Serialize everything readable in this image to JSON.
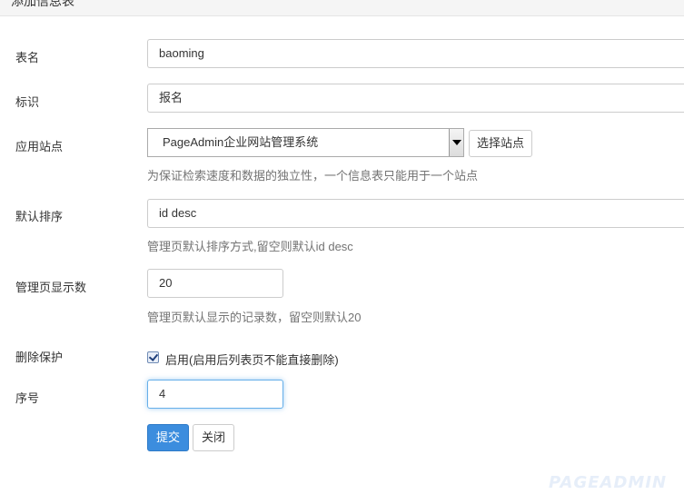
{
  "header": {
    "title": "添加信息表"
  },
  "form": {
    "table_name": {
      "label": "表名",
      "value": "baoming"
    },
    "identifier": {
      "label": "标识",
      "value": "报名"
    },
    "site": {
      "label": "应用站点",
      "selected": "PageAdmin企业网站管理系统",
      "choose_button": "选择站点",
      "hint": "为保证检索速度和数据的独立性，一个信息表只能用于一个站点"
    },
    "default_sort": {
      "label": "默认排序",
      "value": "id desc",
      "hint": "管理页默认排序方式,留空则默认id desc"
    },
    "page_size": {
      "label": "管理页显示数",
      "value": "20",
      "hint": "管理页默认显示的记录数，留空则默认20"
    },
    "delete_protect": {
      "label": "删除保护",
      "checked": true,
      "checkbox_label": "启用(启用后列表页不能直接删除)"
    },
    "order": {
      "label": "序号",
      "value": "4"
    }
  },
  "actions": {
    "submit": "提交",
    "close": "关闭"
  },
  "watermark": "PAGEADMIN",
  "colors": {
    "primary": "#3c8dde",
    "hint": "#737373",
    "focus": "#66afe9"
  }
}
